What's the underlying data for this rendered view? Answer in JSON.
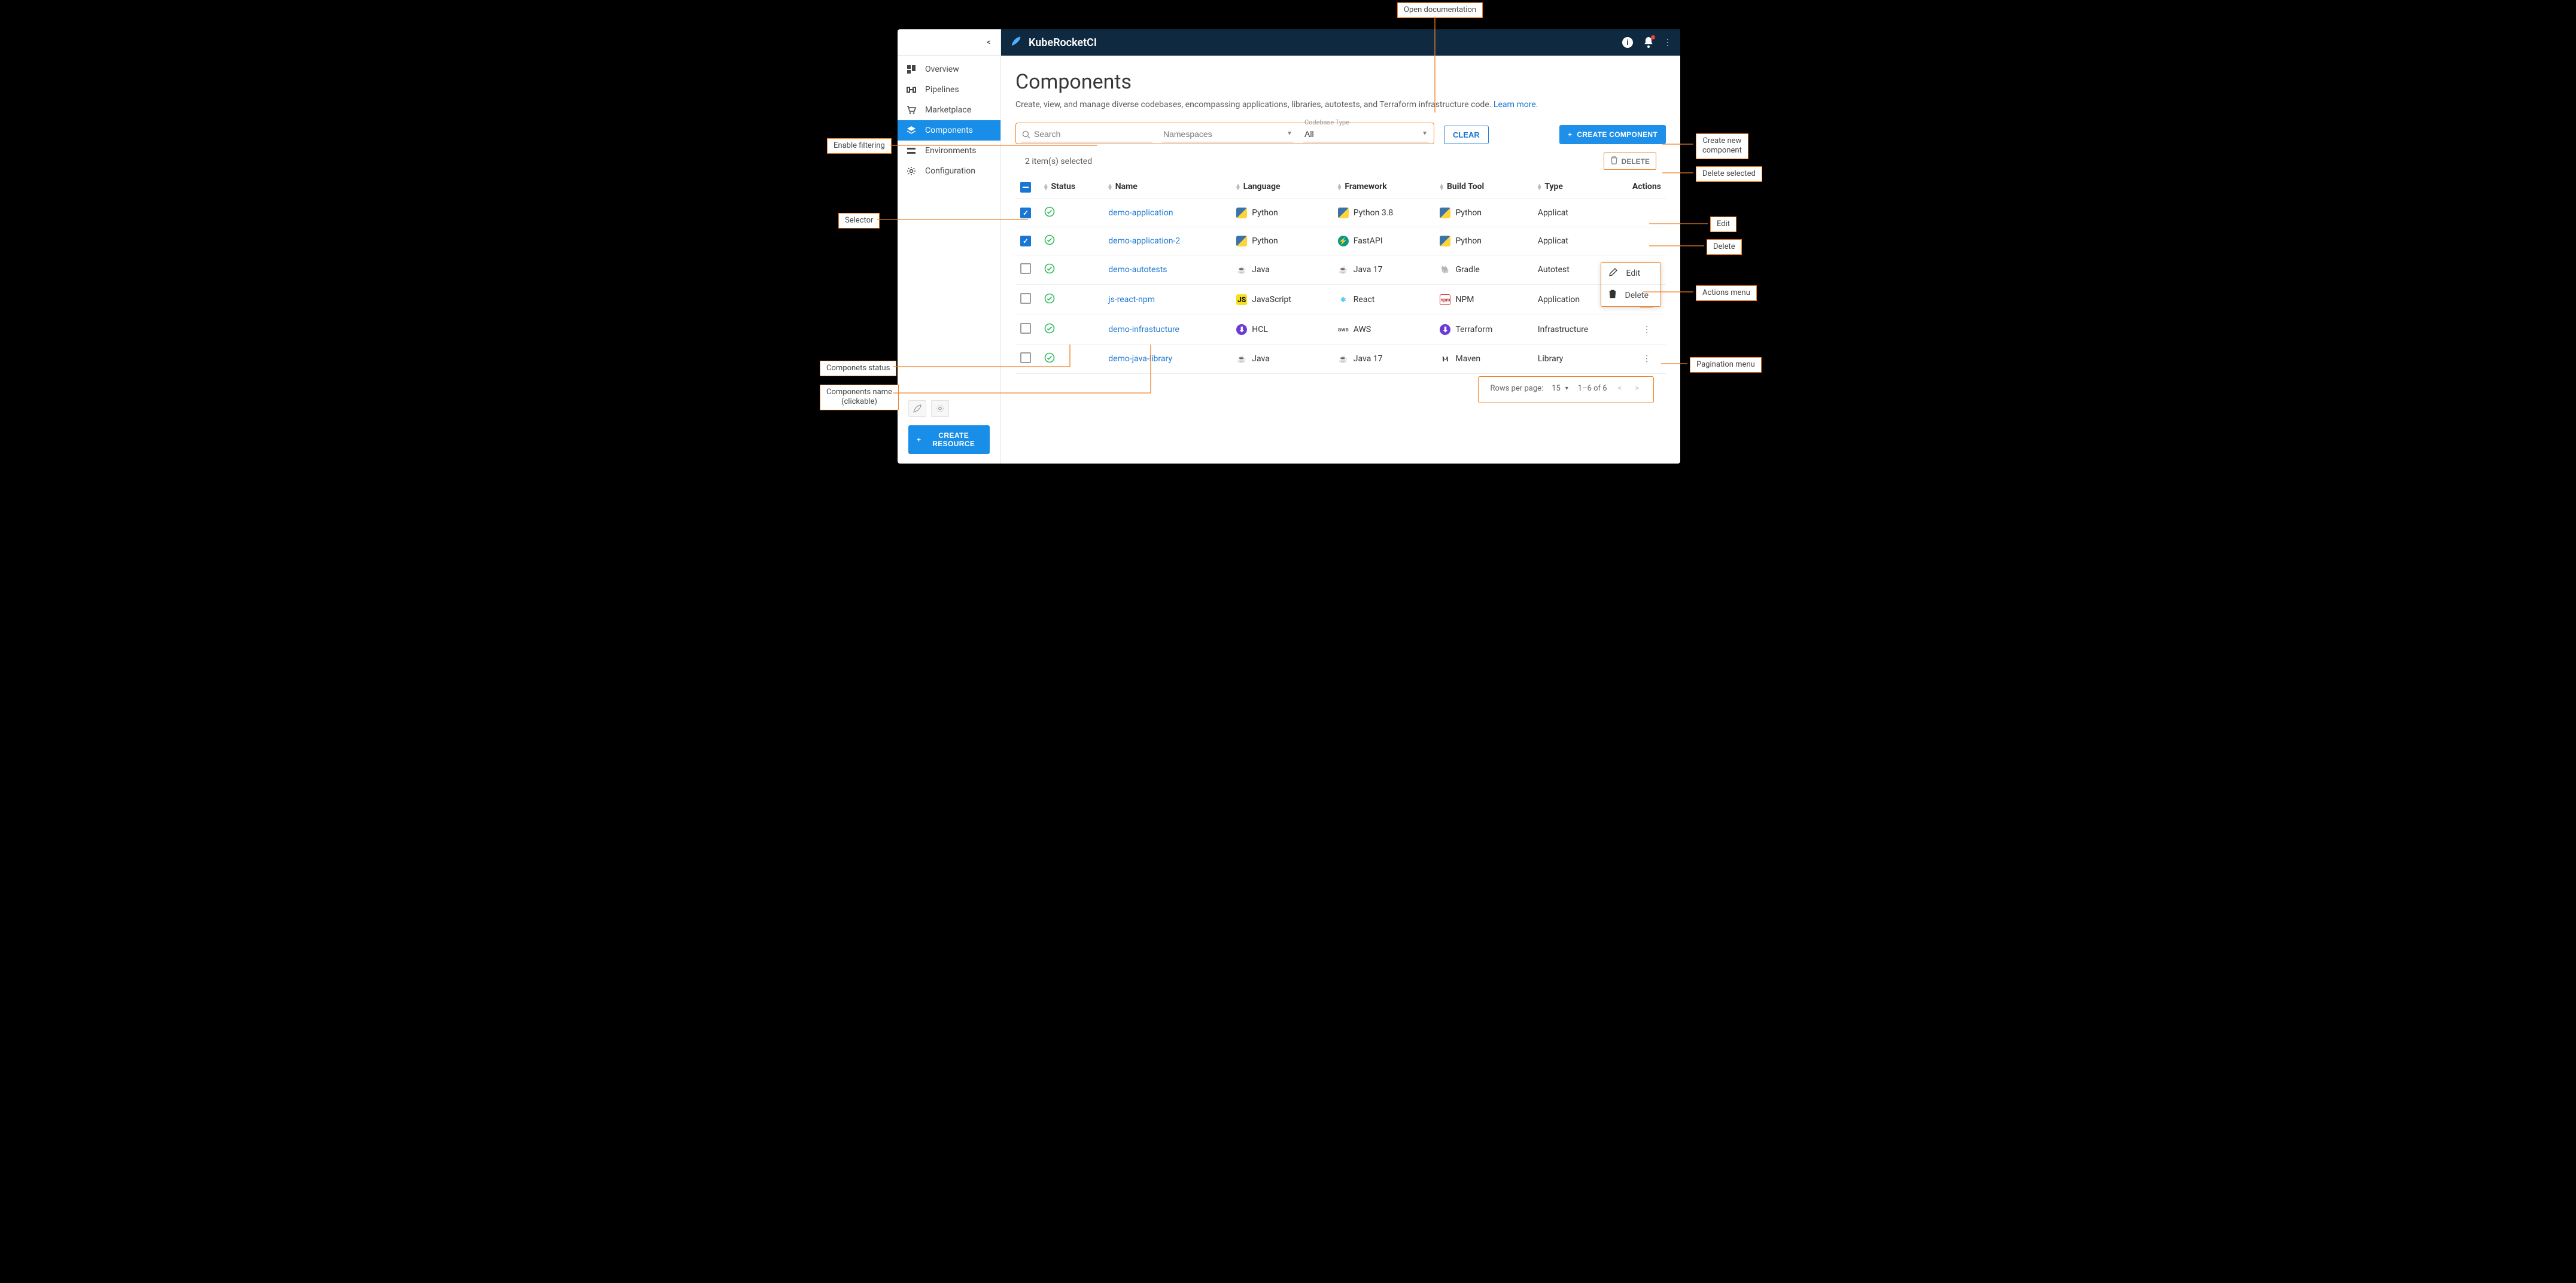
{
  "brand": "KubeRocketCI",
  "sidebar": {
    "collapse": "<",
    "items": [
      {
        "label": "Overview"
      },
      {
        "label": "Pipelines"
      },
      {
        "label": "Marketplace"
      },
      {
        "label": "Components"
      },
      {
        "label": "Environments"
      },
      {
        "label": "Configuration"
      }
    ],
    "create_resource": "CREATE RESOURCE"
  },
  "page": {
    "title": "Components",
    "subtitle": "Create, view, and manage diverse codebases, encompassing applications, libraries, autotests, and Terraform infrastructure code.",
    "learn_more": "Learn more."
  },
  "filters": {
    "search_placeholder": "Search",
    "namespaces_placeholder": "Namespaces",
    "codebase_type_label": "Codebase Type",
    "codebase_type_value": "All",
    "clear": "CLEAR",
    "create_component": "CREATE COMPONENT"
  },
  "selection": {
    "text": "2 item(s) selected",
    "delete": "DELETE"
  },
  "columns": {
    "status": "Status",
    "name": "Name",
    "language": "Language",
    "framework": "Framework",
    "build_tool": "Build Tool",
    "type": "Type",
    "actions": "Actions"
  },
  "rows": [
    {
      "checked": true,
      "name": "demo-application",
      "language": "Python",
      "framework": "Python 3.8",
      "build_tool": "Python",
      "type": "Applicat",
      "lang_icon": "py",
      "fw_icon": "py",
      "bt_icon": "py"
    },
    {
      "checked": true,
      "name": "demo-application-2",
      "language": "Python",
      "framework": "FastAPI",
      "build_tool": "Python",
      "type": "Applicat",
      "lang_icon": "py",
      "fw_icon": "fastapi",
      "bt_icon": "py"
    },
    {
      "checked": false,
      "name": "demo-autotests",
      "language": "Java",
      "framework": "Java 17",
      "build_tool": "Gradle",
      "type": "Autotest",
      "lang_icon": "java",
      "fw_icon": "java",
      "bt_icon": "gradle"
    },
    {
      "checked": false,
      "name": "js-react-npm",
      "language": "JavaScript",
      "framework": "React",
      "build_tool": "NPM",
      "type": "Application",
      "lang_icon": "js",
      "fw_icon": "react",
      "bt_icon": "npm"
    },
    {
      "checked": false,
      "name": "demo-infrastucture",
      "language": "HCL",
      "framework": "AWS",
      "build_tool": "Terraform",
      "type": "Infrastructure",
      "lang_icon": "hcl",
      "fw_icon": "aws",
      "bt_icon": "terraform"
    },
    {
      "checked": false,
      "name": "demo-java-library",
      "language": "Java",
      "framework": "Java 17",
      "build_tool": "Maven",
      "type": "Library",
      "lang_icon": "java",
      "fw_icon": "java",
      "bt_icon": "maven"
    }
  ],
  "context_menu": {
    "edit": "Edit",
    "delete": "Delete"
  },
  "pagination": {
    "label": "Rows per page:",
    "size": "15",
    "range": "1–6 of 6"
  },
  "callouts": {
    "open_doc": "Open documentation",
    "enable_filtering": "Enable filtering",
    "create_new_component": "Create new\ncomponent",
    "delete_selected": "Delete selected",
    "selector": "Selector",
    "edit": "Edit",
    "delete": "Delete",
    "actions_menu": "Actions menu",
    "pagination_menu": "Pagination menu",
    "components_status": "Componets status",
    "components_name": "Components name\n(clickable)"
  }
}
